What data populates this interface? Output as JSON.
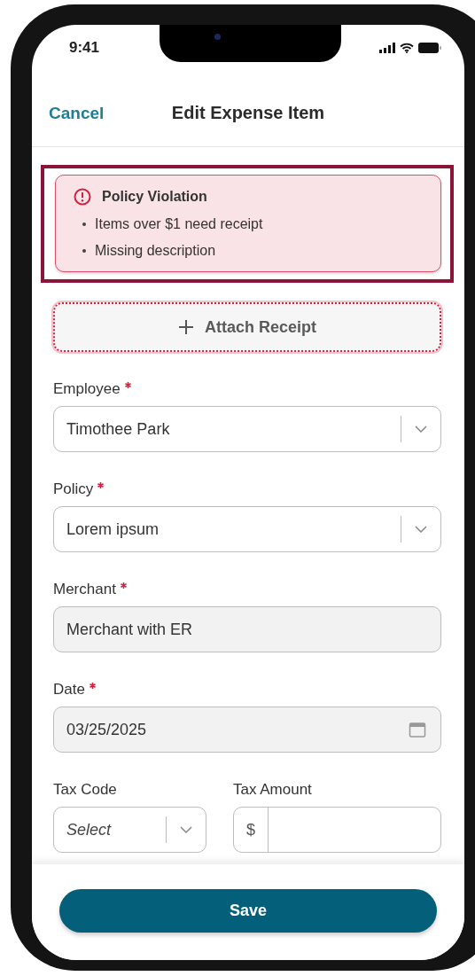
{
  "status_bar": {
    "time": "9:41"
  },
  "header": {
    "cancel": "Cancel",
    "title": "Edit Expense Item"
  },
  "alert": {
    "highlighted": true,
    "title": "Policy Violation",
    "items": [
      "Items over $1 need receipt",
      "Missing description"
    ]
  },
  "attach_button": {
    "label": "Attach Receipt",
    "error": true
  },
  "fields": [
    {
      "kind": "select",
      "label": "Employee",
      "required": true,
      "disabled": false,
      "value": "Timothee Park"
    },
    {
      "kind": "select",
      "label": "Policy",
      "required": true,
      "disabled": false,
      "value": "Lorem ipsum"
    },
    {
      "kind": "text",
      "label": "Merchant",
      "required": true,
      "disabled": true,
      "value": "Merchant with ER"
    },
    {
      "kind": "date",
      "label": "Date",
      "required": true,
      "disabled": true,
      "value": "03/25/2025"
    }
  ],
  "tax_row": [
    {
      "kind": "select",
      "label": "Tax Code",
      "required": false,
      "disabled": false,
      "placeholder": "Select"
    },
    {
      "kind": "currency",
      "label": "Tax Amount",
      "required": false,
      "disabled": false,
      "prefix": "$"
    }
  ],
  "save_button": {
    "label": "Save"
  }
}
